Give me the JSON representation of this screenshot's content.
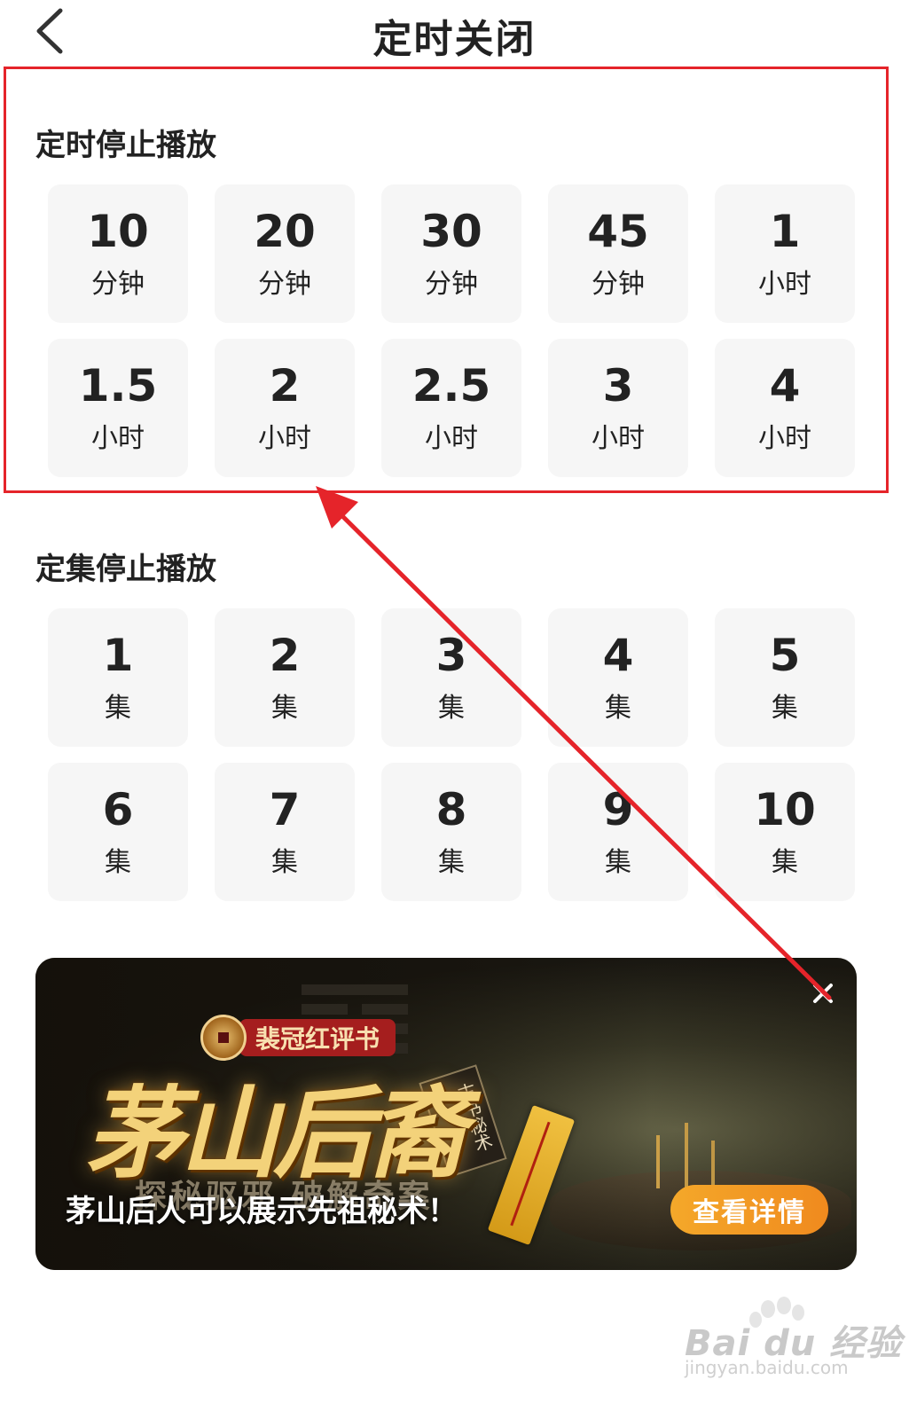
{
  "header": {
    "title": "定时关闭"
  },
  "timer_section": {
    "title": "定时停止播放",
    "options": [
      {
        "value": "10",
        "unit": "分钟"
      },
      {
        "value": "20",
        "unit": "分钟"
      },
      {
        "value": "30",
        "unit": "分钟"
      },
      {
        "value": "45",
        "unit": "分钟"
      },
      {
        "value": "1",
        "unit": "小时"
      },
      {
        "value": "1.5",
        "unit": "小时"
      },
      {
        "value": "2",
        "unit": "小时"
      },
      {
        "value": "2.5",
        "unit": "小时"
      },
      {
        "value": "3",
        "unit": "小时"
      },
      {
        "value": "4",
        "unit": "小时"
      }
    ]
  },
  "episode_section": {
    "title": "定集停止播放",
    "options": [
      {
        "value": "1",
        "unit": "集"
      },
      {
        "value": "2",
        "unit": "集"
      },
      {
        "value": "3",
        "unit": "集"
      },
      {
        "value": "4",
        "unit": "集"
      },
      {
        "value": "5",
        "unit": "集"
      },
      {
        "value": "6",
        "unit": "集"
      },
      {
        "value": "7",
        "unit": "集"
      },
      {
        "value": "8",
        "unit": "集"
      },
      {
        "value": "9",
        "unit": "集"
      },
      {
        "value": "10",
        "unit": "集"
      }
    ]
  },
  "ad_banner": {
    "brand": "裴冠红评书",
    "logo_text": "茅山后裔",
    "book_tag": "古书秘术",
    "subtitle": "探秘驱邪 破解奇案",
    "description": "茅山后人可以展示先祖秘术！",
    "cta_label": "查看详情"
  },
  "watermark": {
    "text": "Bai du 经验",
    "url": "jingyan.baidu.com"
  },
  "colors": {
    "annotation_red": "#e5242a",
    "tile_bg": "#f6f6f6",
    "cta_orange": "#f4a82a"
  }
}
